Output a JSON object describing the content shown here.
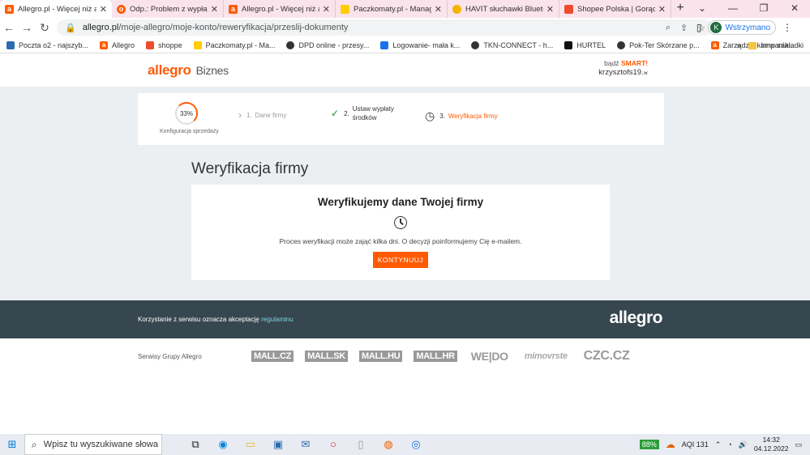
{
  "browser": {
    "tabs": [
      {
        "title": "Allegro.pl - Więcej niż aukc",
        "favicon": "allegro-a",
        "color": "#ff5a00",
        "active": true
      },
      {
        "title": "Odp.: Problem z wypłatą śr",
        "favicon": "outlook",
        "color": "#ff5a00"
      },
      {
        "title": "Allegro.pl - Więcej niż aukc",
        "favicon": "allegro-a",
        "color": "#ff5a00"
      },
      {
        "title": "Paczkomaty.pl - Manager p",
        "favicon": "inpost",
        "color": "#ffcd00"
      },
      {
        "title": "HAVIT słuchawki Bluetooth",
        "favicon": "havit",
        "color": "#f4b400"
      },
      {
        "title": "Shopee Polska | Gorące ofe",
        "favicon": "shopee",
        "color": "#ee4d2d"
      }
    ],
    "new_tab": "+",
    "url_domain": "allegro.pl",
    "url_path": "/moje-allegro/moje-konto/reweryfikacja/przeslij-dokumenty",
    "profile_initial": "K",
    "profile_status": "Wstrzymano",
    "bookmarks": [
      {
        "label": "Poczta o2 - najszyb...",
        "color": "#2b6cb0"
      },
      {
        "label": "Allegro",
        "color": "#ff5a00"
      },
      {
        "label": "shoppe",
        "color": "#ee4d2d"
      },
      {
        "label": "Paczkomaty.pl - Ma...",
        "color": "#ffcd00"
      },
      {
        "label": "DPD online - przesy...",
        "color": "#333333"
      },
      {
        "label": "Logowanie- mała k...",
        "color": "#1a73e8"
      },
      {
        "label": "TKN-CONNECT - h...",
        "color": "#333333"
      },
      {
        "label": "HURTEL",
        "color": "#111111"
      },
      {
        "label": "Pok-Ter Skórzane p...",
        "color": "#333333"
      },
      {
        "label": "Zarządzaj kampania...",
        "color": "#ff5a00"
      }
    ],
    "bookmarks_more": "»",
    "other_bookmarks": "Inne zakładki"
  },
  "header": {
    "logo": "allegro",
    "logo_sub": "Biznes",
    "badge_prefix": "bądź",
    "badge_smart": "SMART!",
    "username": "krzysztofs19..."
  },
  "steps": {
    "progress": "33%",
    "progress_label": "Konfiguracja sprzedaży",
    "items": [
      {
        "num": "1.",
        "label": "Dane firmy"
      },
      {
        "num": "2.",
        "label": "Ustaw wypłaty środków"
      },
      {
        "num": "3.",
        "label": "Weryfikacja firmy"
      }
    ]
  },
  "page": {
    "title": "Weryfikacja firmy",
    "card_heading": "Weryfikujemy dane Twojej firmy",
    "card_text": "Proces weryfikacji może zająć kilka dni. O decyzji poinformujemy Cię e-mailem.",
    "button": "KONTYNUUJ"
  },
  "footer": {
    "text": "Korzystanie z serwisu oznacza akceptację",
    "link": "regulaminu",
    "logo": "allegro"
  },
  "group": {
    "label": "Serwisy Grupy Allegro",
    "brands": [
      "MALL.CZ",
      "MALL.SK",
      "MALL.HU",
      "MALL.HR",
      "WE|DO",
      "mimovrste",
      "CZC.CZ"
    ]
  },
  "taskbar": {
    "search_placeholder": "Wpisz tu wyszukiwane słowa",
    "battery": "88%",
    "aqi": "AQI 131",
    "time": "14:32",
    "date": "04.12.2022"
  }
}
